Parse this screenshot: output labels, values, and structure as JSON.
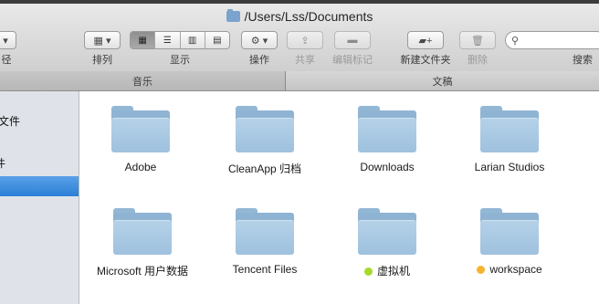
{
  "window": {
    "title": "/Users/Lss/Documents"
  },
  "toolbar": {
    "path_label": "径",
    "arrange_label": "排列",
    "view_label": "显示",
    "action_label": "操作",
    "share_label": "共享",
    "edit_tags_label": "编辑标记",
    "new_folder_label": "新建文件夹",
    "delete_label": "删除",
    "search_label": "搜索"
  },
  "tabs": [
    {
      "label": "音乐"
    },
    {
      "label": "文稿"
    }
  ],
  "sidebar": {
    "items": [
      {
        "label": "文件"
      },
      {
        "label": "件"
      }
    ]
  },
  "folders": [
    {
      "name": "Adobe",
      "tag_color": ""
    },
    {
      "name": "CleanApp 归档",
      "tag_color": ""
    },
    {
      "name": "Downloads",
      "tag_color": ""
    },
    {
      "name": "Larian Studios",
      "tag_color": ""
    },
    {
      "name": "Microsoft 用户数据",
      "tag_color": ""
    },
    {
      "name": "Tencent Files",
      "tag_color": ""
    },
    {
      "name": "虚拟机",
      "tag_color": "#a7d92b"
    },
    {
      "name": "workspace",
      "tag_color": "#f5b330"
    }
  ],
  "colors": {
    "selection": "#2b7fd6",
    "green_tag": "#a7d92b",
    "orange_tag": "#f5b330"
  }
}
